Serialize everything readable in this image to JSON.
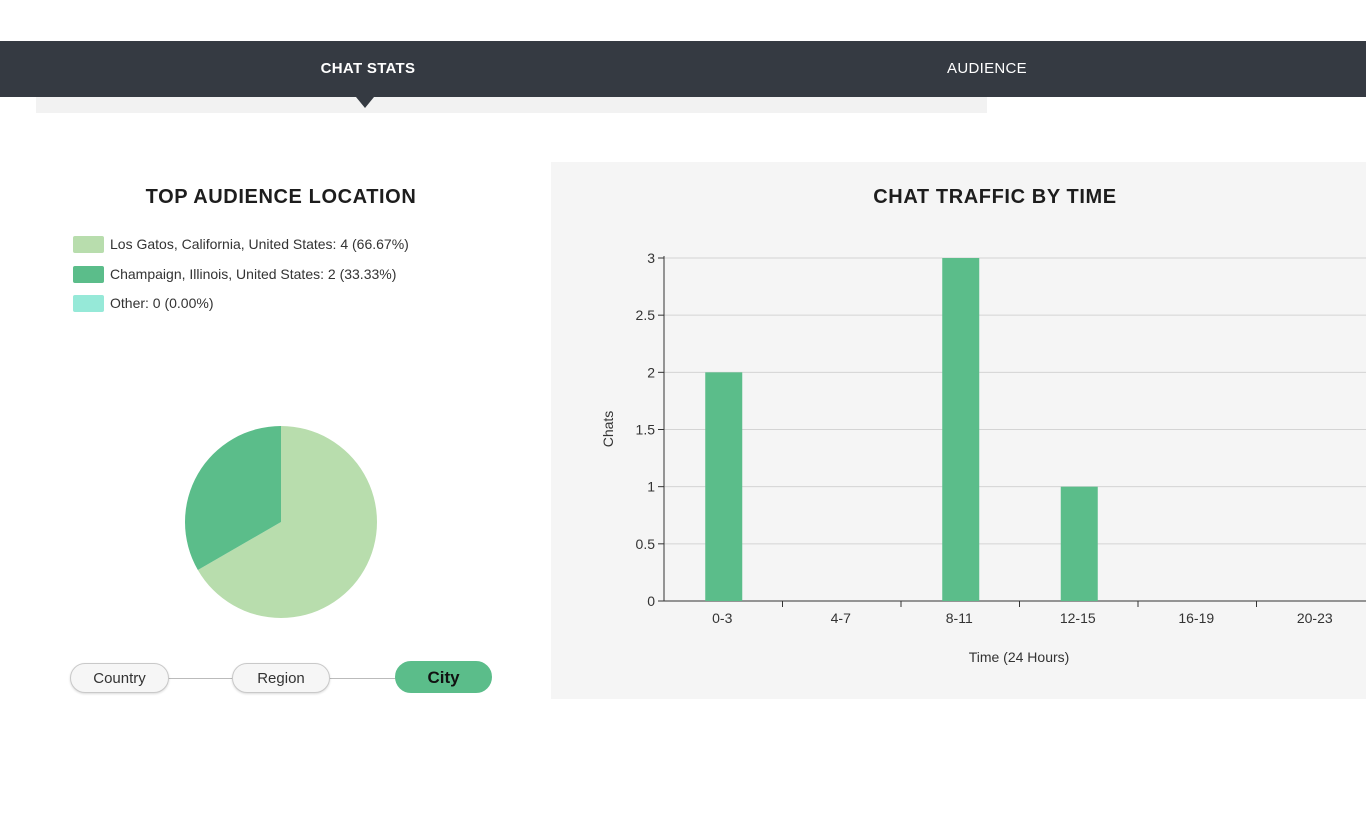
{
  "tabs": {
    "chat_stats": "CHAT STATS",
    "audience": "AUDIENCE"
  },
  "location": {
    "title": "TOP AUDIENCE LOCATION",
    "legend": [
      {
        "label": "Los Gatos, California, United States: 4 (66.67%)",
        "color": "#b8ddad"
      },
      {
        "label": "Champaign, Illinois, United States: 2 (33.33%)",
        "color": "#5bbd8a"
      },
      {
        "label": "Other: 0 (0.00%)",
        "color": "#96e9d8"
      }
    ],
    "slices": [
      {
        "name": "Los Gatos, California, United States",
        "value": 4,
        "color": "#b8ddad"
      },
      {
        "name": "Champaign, Illinois, United States",
        "value": 2,
        "color": "#5bbd8a"
      },
      {
        "name": "Other",
        "value": 0,
        "color": "#96e9d8"
      }
    ],
    "levels": {
      "country": "Country",
      "region": "Region",
      "city": "City"
    },
    "selected_level": "City"
  },
  "chart_data": {
    "type": "bar",
    "title": "CHAT TRAFFIC BY TIME",
    "categories": [
      "0-3",
      "4-7",
      "8-11",
      "12-15",
      "16-19",
      "20-23"
    ],
    "values": [
      2,
      0,
      3,
      1,
      0,
      0
    ],
    "xlabel": "Time (24 Hours)",
    "ylabel": "Chats",
    "ylim": [
      0,
      3
    ],
    "yticks": [
      0,
      0.5,
      1,
      1.5,
      2,
      2.5,
      3
    ],
    "grid": true,
    "color": "#5bbd8a"
  }
}
